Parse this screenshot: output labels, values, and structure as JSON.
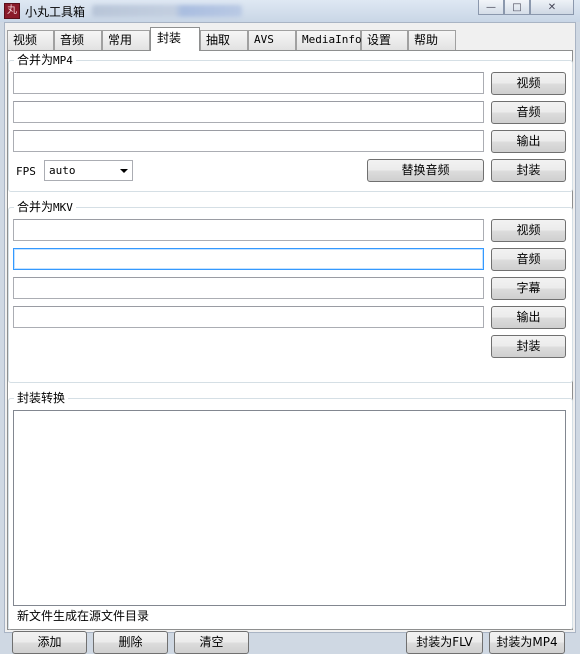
{
  "window": {
    "icon_glyph": "丸",
    "title": "小丸工具箱",
    "controls": {
      "minimize": "—",
      "maximize": "□",
      "close": "✕"
    }
  },
  "tabs": [
    {
      "label": "视频"
    },
    {
      "label": "音频"
    },
    {
      "label": "常用"
    },
    {
      "label": "封装",
      "active": true
    },
    {
      "label": "抽取"
    },
    {
      "label": "AVS"
    },
    {
      "label": "MediaInfo"
    },
    {
      "label": "设置"
    },
    {
      "label": "帮助"
    }
  ],
  "mp4": {
    "group_title_prefix": "合并为",
    "group_title_suffix": "MP4",
    "video_button": "视频",
    "audio_button": "音频",
    "output_button": "输出",
    "fps_label": "FPS",
    "fps_value": "auto",
    "replace_audio_button": "替换音频",
    "mux_button": "封装"
  },
  "mkv": {
    "group_title_prefix": "合并为",
    "group_title_suffix": "MKV",
    "video_button": "视频",
    "audio_button": "音频",
    "subtitle_button": "字幕",
    "output_button": "输出",
    "mux_button": "封装"
  },
  "convert": {
    "group_title": "封装转换",
    "note": "新文件生成在源文件目录",
    "add_button": "添加",
    "delete_button": "删除",
    "clear_button": "清空",
    "to_flv_button": "封装为FLV",
    "to_mp4_button": "封装为MP4"
  }
}
